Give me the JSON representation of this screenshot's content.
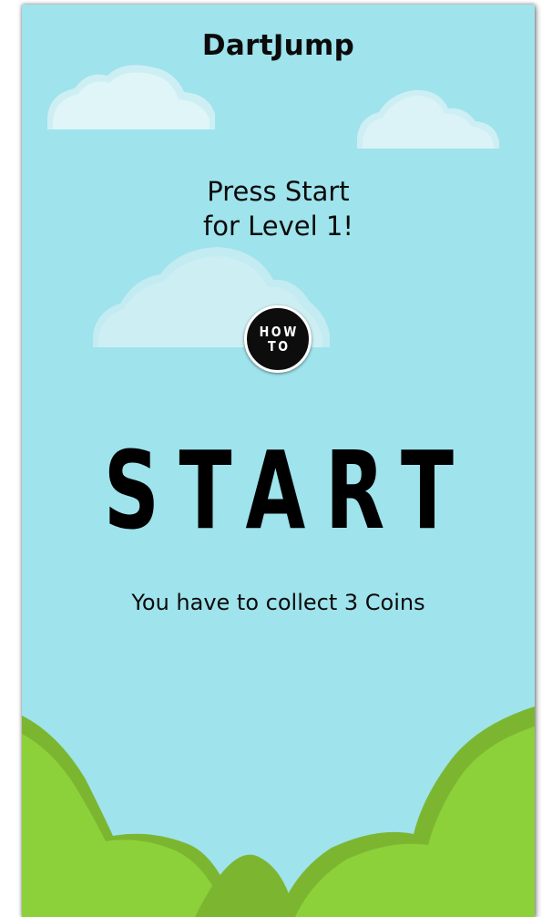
{
  "game": {
    "title": "DartJump",
    "prompt_line1": "Press Start",
    "prompt_line2": "for Level 1!",
    "how_to_line1": "HOW",
    "how_to_line2": "TO",
    "start_label": "START",
    "coin_goal": "You have to collect 3 Coins"
  },
  "colors": {
    "sky": "#9fe3ec",
    "cloud": "#cdeff4",
    "hill_dark": "#7cb631",
    "hill_light": "#8cd13a",
    "text": "#0b0b0b"
  }
}
